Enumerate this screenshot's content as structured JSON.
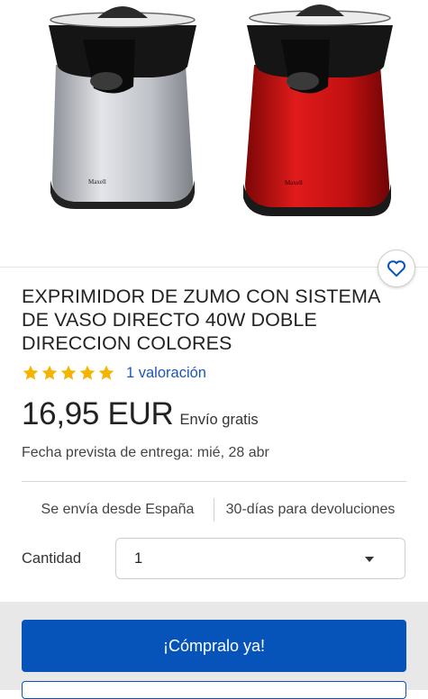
{
  "product": {
    "image_alt": "two citrus juicers (silver and red)",
    "image_brand_text": "Maxell",
    "title": "EXPRIMIDOR DE ZUMO CON SISTEMA DE VASO DIRECTO 40W DOBLE DIRECCION COLORES",
    "rating_stars": 5,
    "rating_link": "1 valoración",
    "price": "16,95 EUR",
    "shipping": "Envío gratis",
    "delivery": "Fecha prevista de entrega: mié, 28 abr"
  },
  "shipping_info": {
    "from": "Se envía desde España",
    "returns": "30-días para devoluciones"
  },
  "quantity": {
    "label": "Cantidad",
    "value": "1"
  },
  "actions": {
    "buy_now": "¡Cómpralo ya!"
  },
  "icons": {
    "favorite": "heart-outline-icon",
    "dropdown": "caret-down-icon",
    "star": "star-icon"
  },
  "colors": {
    "primary_blue": "#0654ba",
    "link_blue": "#1e55b5",
    "star_gold": "#f5b400",
    "juicer_red": "#c41414",
    "juicer_silver": "#b9bcc2"
  }
}
